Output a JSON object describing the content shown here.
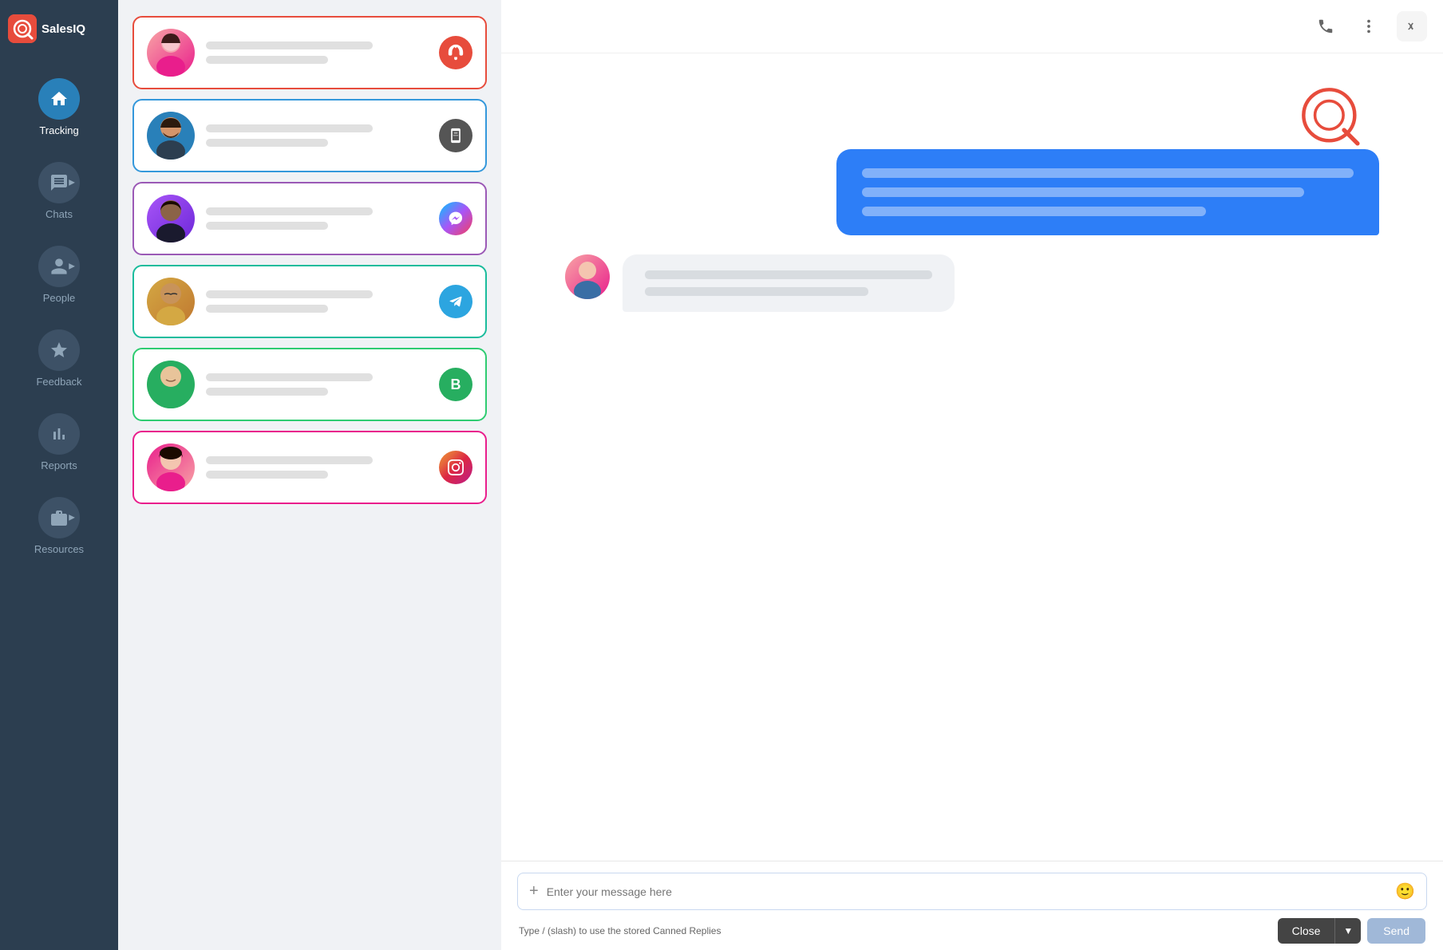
{
  "app": {
    "name": "SalesIQ",
    "logo_letter": "Q"
  },
  "sidebar": {
    "items": [
      {
        "id": "tracking",
        "label": "Tracking",
        "icon": "home",
        "active": true,
        "has_chevron": false
      },
      {
        "id": "chats",
        "label": "Chats",
        "icon": "chat",
        "active": false,
        "has_chevron": true
      },
      {
        "id": "people",
        "label": "People",
        "icon": "person",
        "active": false,
        "has_chevron": true
      },
      {
        "id": "feedback",
        "label": "Feedback",
        "icon": "star",
        "active": false,
        "has_chevron": false
      },
      {
        "id": "reports",
        "label": "Reports",
        "icon": "bar-chart",
        "active": false,
        "has_chevron": false
      },
      {
        "id": "resources",
        "label": "Resources",
        "icon": "briefcase",
        "active": false,
        "has_chevron": true
      }
    ]
  },
  "chat_list": {
    "cards": [
      {
        "id": 1,
        "border": "red",
        "avatar_class": "avatar-1",
        "channel": "support",
        "channel_emoji": "🎧"
      },
      {
        "id": 2,
        "border": "blue",
        "avatar_class": "avatar-2",
        "channel": "mobile",
        "channel_emoji": "📱"
      },
      {
        "id": 3,
        "border": "purple",
        "avatar_class": "avatar-3",
        "channel": "messenger",
        "channel_emoji": "💬"
      },
      {
        "id": 4,
        "border": "teal",
        "avatar_class": "avatar-4",
        "channel": "telegram",
        "channel_emoji": "✈"
      },
      {
        "id": 5,
        "border": "green",
        "avatar_class": "avatar-5",
        "channel": "businesschat",
        "channel_emoji": "B"
      },
      {
        "id": 6,
        "border": "pink",
        "avatar_class": "avatar-6",
        "channel": "instagram",
        "channel_emoji": "📷"
      }
    ]
  },
  "input": {
    "placeholder": "Enter your message here",
    "canned_hint": "Type / (slash) to use the stored Canned Replies",
    "close_label": "Close",
    "send_label": "Send"
  },
  "header": {
    "phone_icon": "📞",
    "more_icon": "⋮",
    "expand_icon": "»"
  }
}
